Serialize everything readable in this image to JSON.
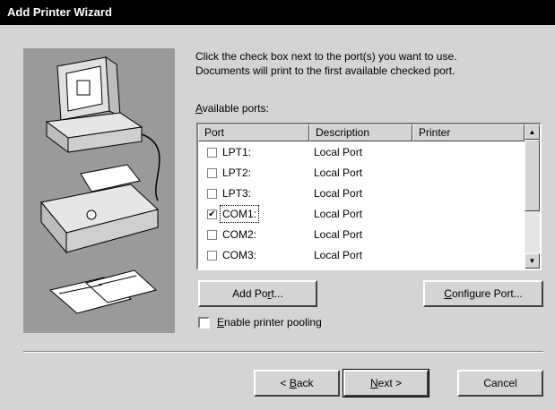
{
  "window": {
    "title": "Add Printer Wizard"
  },
  "instructions": {
    "line1": "Click the check box next to the port(s) you want to use.",
    "line2": "Documents will print to the first available checked port."
  },
  "available_ports": {
    "label_accel": "A",
    "label_rest": "vailable ports:",
    "columns": [
      "Port",
      "Description",
      "Printer"
    ],
    "rows": [
      {
        "port": "LPT1:",
        "description": "Local Port",
        "printer": "",
        "checked": false
      },
      {
        "port": "LPT2:",
        "description": "Local Port",
        "printer": "",
        "checked": false
      },
      {
        "port": "LPT3:",
        "description": "Local Port",
        "printer": "",
        "checked": false
      },
      {
        "port": "COM1:",
        "description": "Local Port",
        "printer": "",
        "checked": true
      },
      {
        "port": "COM2:",
        "description": "Local Port",
        "printer": "",
        "checked": false
      },
      {
        "port": "COM3:",
        "description": "Local Port",
        "printer": "",
        "checked": false
      }
    ]
  },
  "buttons": {
    "add_port": {
      "pre": "Add Po",
      "accel": "r",
      "post": "t..."
    },
    "configure_port": {
      "pre": "",
      "accel": "C",
      "post": "onfigure Port..."
    },
    "back": {
      "pre": "< ",
      "accel": "B",
      "post": "ack"
    },
    "next": {
      "pre": "",
      "accel": "N",
      "post": "ext >"
    },
    "cancel": {
      "label": "Cancel"
    }
  },
  "pooling": {
    "accel": "E",
    "rest": "nable printer pooling",
    "checked": false
  },
  "icons": {
    "checkmark": "✔",
    "scroll_up": "▲",
    "scroll_down": "▼"
  }
}
